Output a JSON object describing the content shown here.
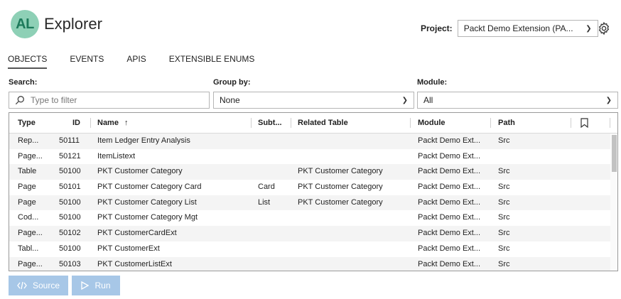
{
  "app": {
    "badge": "AL",
    "title": "Explorer"
  },
  "project": {
    "label": "Project:",
    "value": "Packt Demo Extension (PA..."
  },
  "icons": {
    "settings": "gear-icon",
    "search": "search-icon",
    "sort": "sort-ascending-icon",
    "bookmark": "bookmark-icon",
    "source": "code-icon",
    "run": "play-icon"
  },
  "tabs": [
    {
      "label": "OBJECTS",
      "active": true
    },
    {
      "label": "EVENTS",
      "active": false
    },
    {
      "label": "APIS",
      "active": false
    },
    {
      "label": "EXTENSIBLE ENUMS",
      "active": false
    }
  ],
  "filters": {
    "search": {
      "label": "Search:",
      "placeholder": "Type to filter"
    },
    "group": {
      "label": "Group by:",
      "value": "None"
    },
    "module": {
      "label": "Module:",
      "value": "All"
    }
  },
  "table": {
    "columns": {
      "type": "Type",
      "id": "ID",
      "name": "Name",
      "sort": "↑",
      "subtype": "Subt...",
      "related": "Related Table",
      "module": "Module",
      "path": "Path"
    },
    "rows": [
      {
        "type": "Rep...",
        "id": "50111",
        "name": "Item Ledger Entry Analysis",
        "subtype": "",
        "related": "",
        "module": "Packt Demo Ext...",
        "path": "Src"
      },
      {
        "type": "Page...",
        "id": "50121",
        "name": "ItemListext",
        "subtype": "",
        "related": "",
        "module": "Packt Demo Ext...",
        "path": ""
      },
      {
        "type": "Table",
        "id": "50100",
        "name": "PKT Customer Category",
        "subtype": "",
        "related": "PKT Customer Category",
        "module": "Packt Demo Ext...",
        "path": "Src"
      },
      {
        "type": "Page",
        "id": "50101",
        "name": "PKT Customer Category Card",
        "subtype": "Card",
        "related": "PKT Customer Category",
        "module": "Packt Demo Ext...",
        "path": "Src"
      },
      {
        "type": "Page",
        "id": "50100",
        "name": "PKT Customer Category List",
        "subtype": "List",
        "related": "PKT Customer Category",
        "module": "Packt Demo Ext...",
        "path": "Src"
      },
      {
        "type": "Cod...",
        "id": "50100",
        "name": "PKT Customer Category Mgt",
        "subtype": "",
        "related": "",
        "module": "Packt Demo Ext...",
        "path": "Src"
      },
      {
        "type": "Page...",
        "id": "50102",
        "name": "PKT CustomerCardExt",
        "subtype": "",
        "related": "",
        "module": "Packt Demo Ext...",
        "path": "Src"
      },
      {
        "type": "Tabl...",
        "id": "50100",
        "name": "PKT CustomerExt",
        "subtype": "",
        "related": "",
        "module": "Packt Demo Ext...",
        "path": "Src"
      },
      {
        "type": "Page...",
        "id": "50103",
        "name": "PKT CustomerListExt",
        "subtype": "",
        "related": "",
        "module": "Packt Demo Ext...",
        "path": "Src"
      }
    ]
  },
  "buttons": {
    "source": "Source",
    "run": "Run"
  }
}
